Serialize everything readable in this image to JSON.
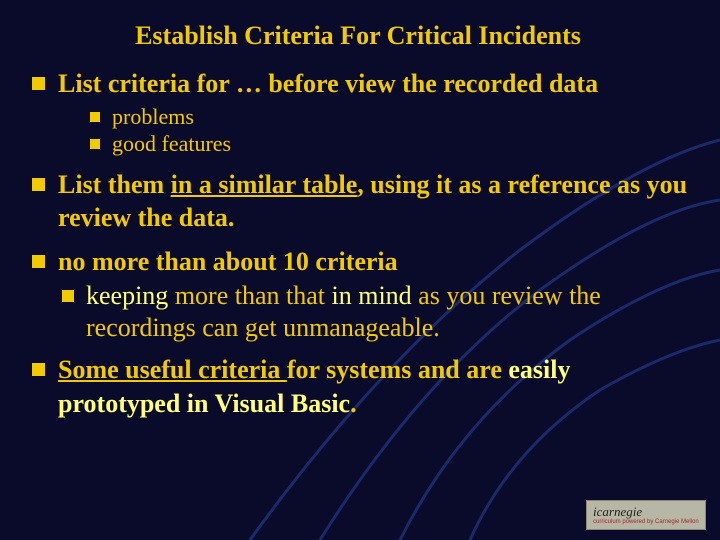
{
  "title": "Establish Criteria For Critical Incidents",
  "bullets": {
    "b1": {
      "text": "List criteria for … before view the recorded data",
      "sub1": "problems",
      "sub2": "good features"
    },
    "b2": {
      "part1": "List them ",
      "part2_u": "in a similar table",
      "part3": ", using it as a reference as you review the data."
    },
    "b3": {
      "text": "no more than about 10 criteria",
      "sub": {
        "p1_hi": "keeping",
        "p2": " more than that ",
        "p3_hi": "in mind",
        "p4": " as you review the recordings can get unmanageable."
      }
    },
    "b4": {
      "p1_u": "Some useful criteria ",
      "p2": "for systems and are ",
      "p3_hi": "easily prototyped in Visual Basic",
      "p4": "."
    }
  },
  "logo": {
    "main": "icarnegie",
    "sub": "curriculum powered by Carnegie Mellon"
  }
}
